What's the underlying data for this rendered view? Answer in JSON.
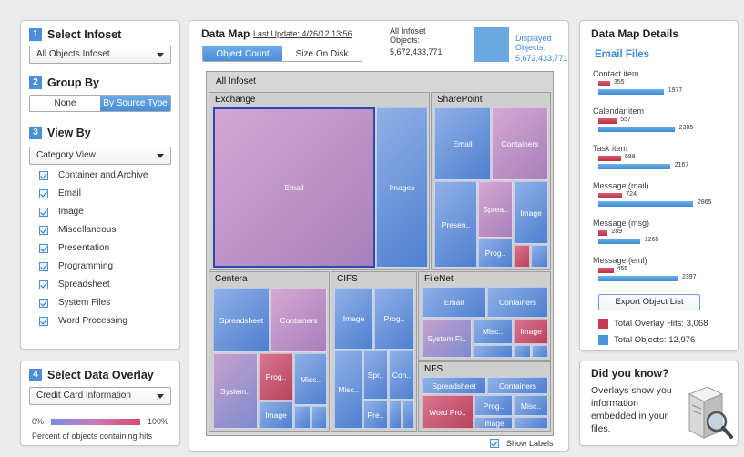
{
  "left": {
    "infoset": {
      "num": "1",
      "title": "Select Infoset",
      "value": "All Objects Infoset"
    },
    "group_by": {
      "num": "2",
      "title": "Group By",
      "options": [
        "None",
        "By Source Type"
      ],
      "selected": "By Source Type"
    },
    "view_by": {
      "num": "3",
      "title": "View By",
      "value": "Category View",
      "categories": [
        "Container and Archive",
        "Email",
        "Image",
        "Miscellaneous",
        "Presentation",
        "Programming",
        "Spreadsheet",
        "System Files",
        "Word Processing"
      ]
    },
    "overlay": {
      "num": "4",
      "title": "Select Data Overlay",
      "value": "Credit Card Information",
      "scale_min": "0%",
      "scale_max": "100%",
      "caption": "Percent of objects containing hits"
    }
  },
  "center": {
    "title": "Data Map",
    "last_update": "Last Update: 4/26/12 13:56",
    "tabs": [
      "Object Count",
      "Size On Disk"
    ],
    "active_tab": "Object Count",
    "all_infoset_label": "All Infoset Objects:",
    "all_infoset_value": "5,672,433,771",
    "displayed_label": "Displayed Objects:",
    "displayed_value": "5,672,433,771",
    "root_label": "All Infoset",
    "groups": {
      "exchange": {
        "label": "Exchange",
        "cells": [
          "Email",
          "Images"
        ]
      },
      "sharepoint": {
        "label": "SharePoint",
        "cells": [
          "Email",
          "Containers",
          "Presen..",
          "Sprea..",
          "Image",
          "Prog.."
        ]
      },
      "centera": {
        "label": "Centera",
        "cells": [
          "Spreadsheet",
          "Containers",
          "System..",
          "Prog..",
          "Misc..",
          "Image"
        ]
      },
      "cifs": {
        "label": "CIFS",
        "cells": [
          "Image",
          "Prog..",
          "Misc..",
          "Spr..",
          "Con..",
          "Pre.."
        ]
      },
      "filenet": {
        "label": "FileNet",
        "cells": [
          "Email",
          "Containers",
          "System Fi..",
          "Misc..",
          "Image"
        ]
      },
      "nfs": {
        "label": "NFS",
        "cells": [
          "Spreadsheet",
          "Containers",
          "Word Pro..",
          "Prog..",
          "Misc..",
          "Image"
        ]
      }
    },
    "show_labels": "Show Labels"
  },
  "details": {
    "title": "Data Map Details",
    "subtitle": "Email Files",
    "items": [
      {
        "label": "Contact item",
        "hits": 355,
        "total": 1977
      },
      {
        "label": "Calendar item",
        "hits": 557,
        "total": 2305
      },
      {
        "label": "Task item",
        "hits": 688,
        "total": 2167
      },
      {
        "label": "Message (mail)",
        "hits": 724,
        "total": 2865
      },
      {
        "label": "Message (msg)",
        "hits": 289,
        "total": 1265
      },
      {
        "label": "Message (eml)",
        "hits": 455,
        "total": 2397
      }
    ],
    "export_button": "Export Object List",
    "legend_hits": "Total Overlay Hits: 3,068",
    "legend_total": "Total Objects: 12,976",
    "colors": {
      "hits": "#c8394f",
      "total": "#4a95dc"
    }
  },
  "tip": {
    "title": "Did you know?",
    "text": "Overlays show you information embedded in your files."
  }
}
